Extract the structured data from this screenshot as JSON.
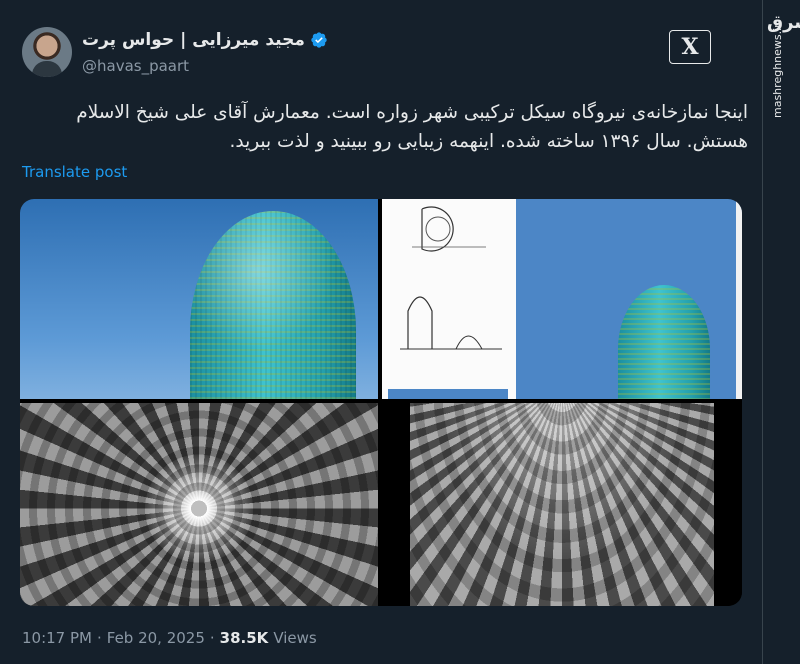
{
  "author": {
    "display_name": "مجید میرزایی | حواس پرت",
    "handle": "@havas_paart"
  },
  "tweet": {
    "text": "اینجا نمازخانه‌ی نیروگاه سیکل ترکیبی شهر زواره است. معمارش آقای علی شیخ الاسلام هستش. سال ۱۳۹۶ ساخته شده. اینهمه زیبایی رو ببینید و لذت ببرید.",
    "translate_label": "Translate post"
  },
  "meta": {
    "time": "10:17 PM",
    "separator1": "·",
    "date": "Feb 20, 2025",
    "separator2": "·",
    "views_count": "38.5K",
    "views_label": "Views"
  },
  "watermark": {
    "logo_text": "مشرق",
    "site": "mashreghnews.ir"
  },
  "icons": {
    "verified": "verified-badge-icon",
    "brand": "x-logo-icon"
  },
  "colors": {
    "background": "#15202b",
    "link": "#1d9bf0",
    "verified": "#1d9bf0",
    "secondary_text": "#8b98a5"
  }
}
